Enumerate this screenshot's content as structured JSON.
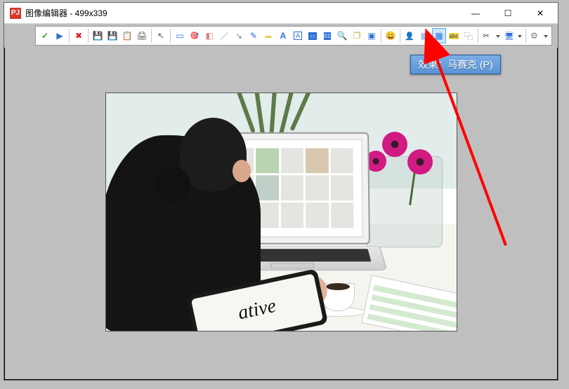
{
  "window": {
    "title": "图像编辑器 - 499x339",
    "app_icon_glyph": "PJ"
  },
  "winbuttons": {
    "minimize": "—",
    "maximize": "☐",
    "close": "✕"
  },
  "toolbar": {
    "confirm": "✓",
    "play": "▶",
    "cancel": "✖",
    "save": "💾",
    "saveas": "💾",
    "clipboard": "📋",
    "print": "🖨",
    "cursor": "↖",
    "rect_select": "▭",
    "color_picker": "🎯",
    "eraser": "◧",
    "line": "／",
    "arrow_tool": "↘",
    "pencil": "✎",
    "marker": "▬",
    "text_a": "A",
    "text_box": "A",
    "counter_rect": "▭",
    "counter_num": "01",
    "zoom": "🔍",
    "layers": "❐",
    "picture": "▣",
    "emoji": "😀",
    "person": "👤",
    "hatch": "▦",
    "mosaic": "▦",
    "abc": "abc",
    "crop": "⿻",
    "tools": "✂",
    "monitor": "🖥",
    "gear": "⚙"
  },
  "tooltip": {
    "text": "效果：马赛克 (P)"
  },
  "canvas": {
    "tablet_text": "ative"
  },
  "annotation": {
    "arrow_color": "#ff0000"
  }
}
